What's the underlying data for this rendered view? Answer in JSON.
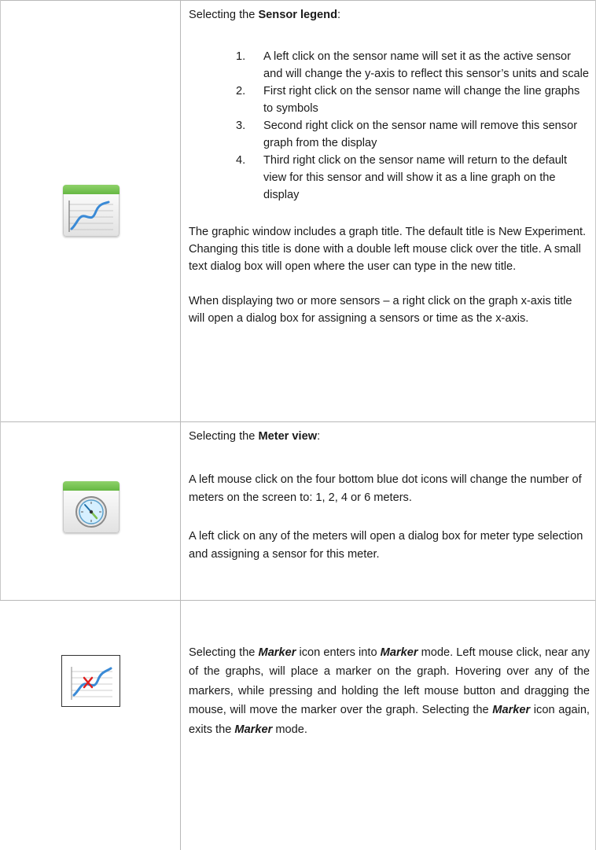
{
  "colors": {
    "icon_green": "#6cbf45",
    "line_blue": "#3a8ad6",
    "marker_red": "#e02020"
  },
  "rows": [
    {
      "icon": "line-graph-icon",
      "heading_prefix": "Selecting the ",
      "heading_bold": "Sensor legend",
      "heading_suffix": ":",
      "list": [
        {
          "num": "1.",
          "text": "A left click on the sensor name will set it as the active sensor and will change the y-axis to reflect this sensor’s units and scale"
        },
        {
          "num": "2.",
          "text": "First right click on the sensor name will change the line graphs to symbols"
        },
        {
          "num": "3.",
          "text": "Second right click on the sensor name will remove this sensor graph from the display"
        },
        {
          "num": "4.",
          "text": "Third right click on the sensor name will return to the default view for this sensor and will show it as a line graph on the display"
        }
      ],
      "para1": "The graphic window includes a graph title. The default title is New Experiment. Changing this title is done with a double left mouse click over the title. A small text dialog box will open where the user can type in the new title.",
      "para2": "When displaying two or more sensors – a right click on the graph x-axis title will open a dialog box for assigning a sensors or time as the x-axis."
    },
    {
      "icon": "meter-gauge-icon",
      "heading_prefix": "Selecting the ",
      "heading_bold": "Meter view",
      "heading_suffix": ":",
      "para1": "A left mouse click on the four bottom blue dot icons will change the number of meters on the screen to: 1, 2, 4 or 6 meters.",
      "para2": "A left click on any of the meters will open a dialog box for meter type selection and assigning a sensor for this meter."
    },
    {
      "icon": "marker-graph-icon",
      "t1": "Selecting the ",
      "b1": "Marker",
      "t2": " icon enters into ",
      "b2": "Marker",
      "t3": " mode. Left mouse click, near any of the graphs, will place a marker on the graph. Hovering over any of the markers, while pressing and holding the left mouse button and dragging the mouse, will move the marker over the graph. Selecting the ",
      "b3": "Marker",
      "t4": " icon again, exits the ",
      "b4": "Marker",
      "t5": " mode."
    }
  ]
}
